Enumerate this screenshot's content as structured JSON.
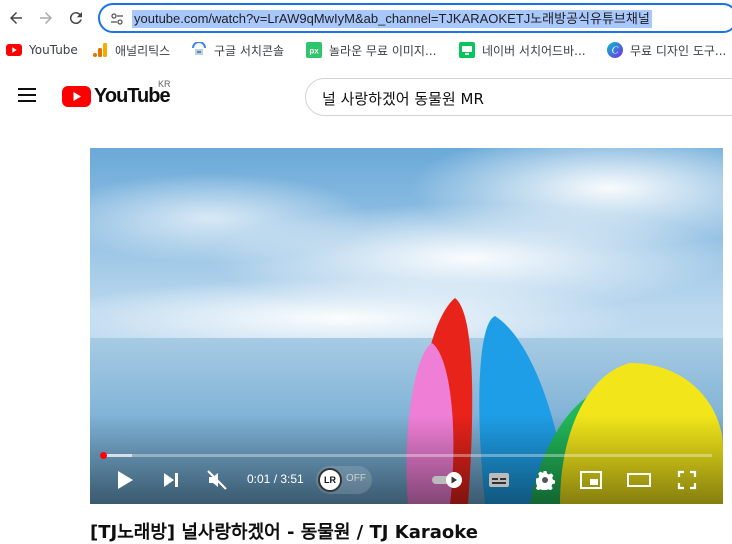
{
  "browser": {
    "url": "youtube.com/watch?v=LrAW9qMwIyM&ab_channel=TJKARAOKETJ노래방공식유튜브채널",
    "bookmarks": [
      {
        "label": "YouTube",
        "icon": "youtube-icon"
      },
      {
        "label": "애널리틱스",
        "icon": "analytics-icon"
      },
      {
        "label": "구글 서치콘솔",
        "icon": "search-console-icon"
      },
      {
        "label": "놀라운 무료 이미지...",
        "icon": "pixabay-icon"
      },
      {
        "label": "네이버 서치어드바...",
        "icon": "naver-icon"
      },
      {
        "label": "무료 디자인 도구...",
        "icon": "canva-icon"
      }
    ]
  },
  "header": {
    "logo_text": "YouTube",
    "region": "KR",
    "search_query": "널 사랑하겠어 동물원 MR"
  },
  "player": {
    "current_time": "0:01",
    "duration": "3:51",
    "time_separator": " / ",
    "progress_fraction": 0.004,
    "lr_badge": "LR",
    "lr_state": "OFF"
  },
  "video": {
    "title": "[TJ노래방] 널사랑하겠어 - 동물원 / TJ Karaoke"
  },
  "colors": {
    "accent": "#1a73e8",
    "youtube_red": "#ff0000",
    "url_highlight": "#a8c7fa"
  }
}
